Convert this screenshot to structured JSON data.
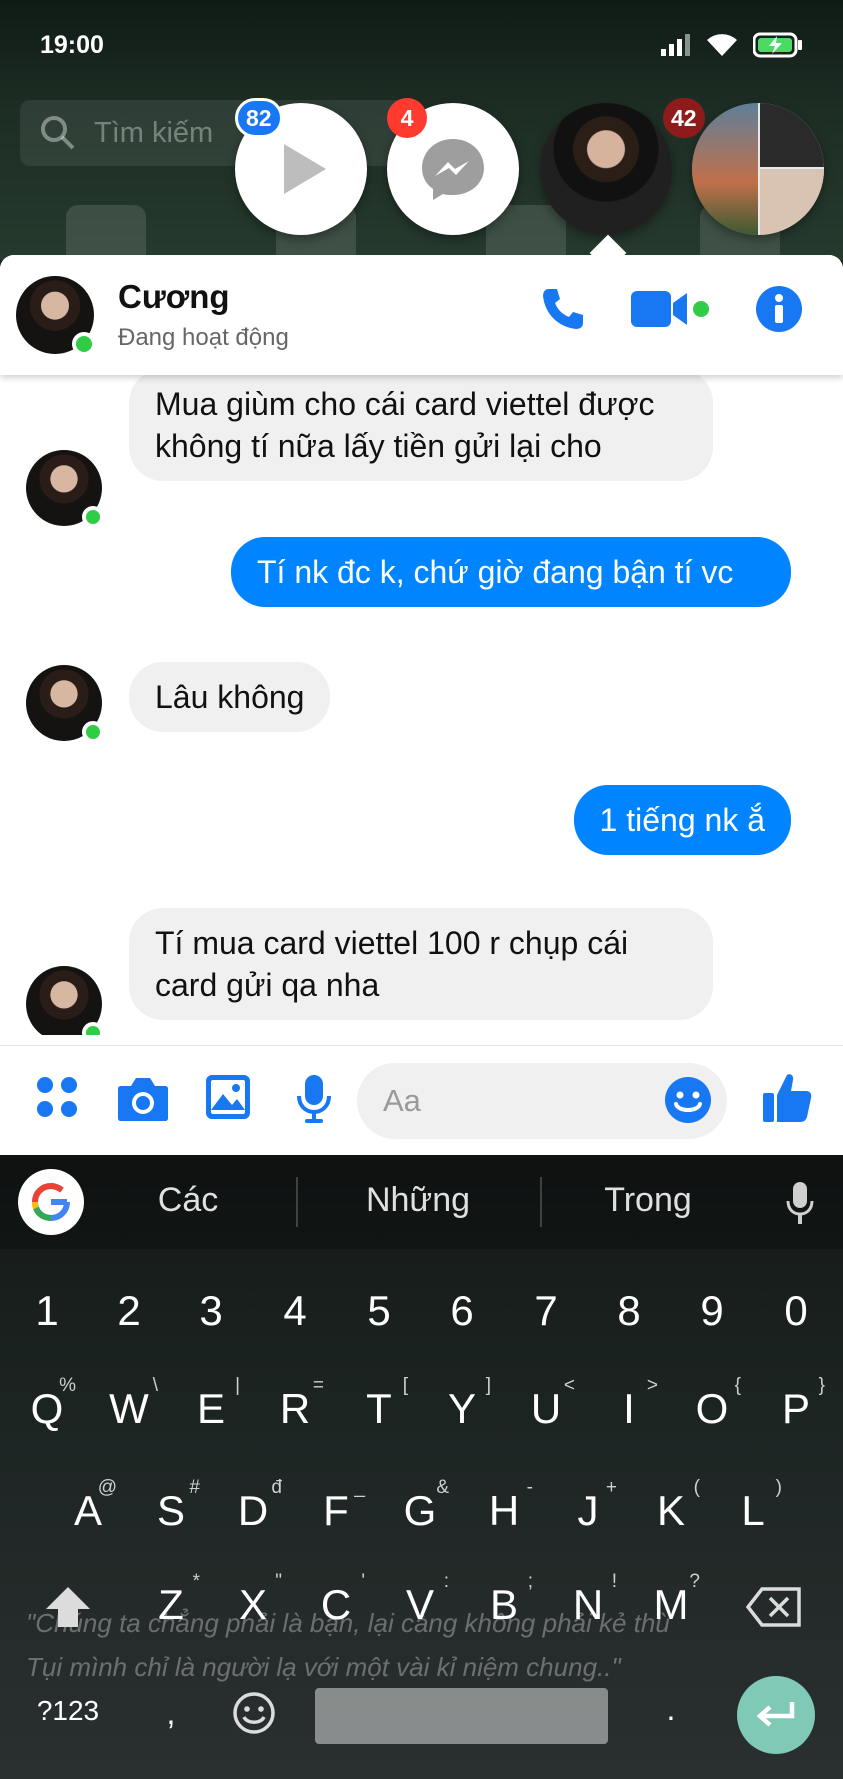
{
  "status_bar": {
    "time": "19:00"
  },
  "background": {
    "search_placeholder": "Tìm kiếm"
  },
  "chat_heads": [
    {
      "name": "video-app",
      "badge": "82"
    },
    {
      "name": "messenger",
      "badge": "4"
    },
    {
      "name": "cuong-avatar",
      "badge": "42"
    },
    {
      "name": "group-avatar",
      "badge": ""
    }
  ],
  "header": {
    "contact_name": "Cương",
    "contact_status": "Đang hoạt động"
  },
  "messages": [
    {
      "direction": "in",
      "text": "Mua giùm cho  cái card viettel được không tí nữa  lấy tiền gửi lại cho"
    },
    {
      "direction": "out",
      "text": "Tí nk đc k, chứ giờ đang bận tí vc"
    },
    {
      "direction": "in",
      "text": "Lâu không"
    },
    {
      "direction": "out",
      "text": "1 tiếng nk ắ"
    },
    {
      "direction": "in",
      "text": "Tí mua card viettel 100 r chụp cái card gửi qa nha"
    }
  ],
  "composer": {
    "placeholder": "Aa"
  },
  "keyboard": {
    "suggestions": [
      "Các",
      "Những",
      "Trong"
    ],
    "numbers": [
      "1",
      "2",
      "3",
      "4",
      "5",
      "6",
      "7",
      "8",
      "9",
      "0"
    ],
    "row1": [
      "Q",
      "W",
      "E",
      "R",
      "T",
      "Y",
      "U",
      "I",
      "O",
      "P"
    ],
    "row1_sub": [
      "%",
      "\\",
      "|",
      "=",
      "[",
      "]",
      "<",
      ">",
      "{",
      "}"
    ],
    "row2": [
      "A",
      "S",
      "D",
      "F",
      "G",
      "H",
      "J",
      "K",
      "L"
    ],
    "row2_sub": [
      "@",
      "#",
      "đ",
      "_",
      "&",
      "-",
      "+",
      "(",
      ")"
    ],
    "row3": [
      "Z",
      "X",
      "C",
      "V",
      "B",
      "N",
      "M"
    ],
    "row3_sub": [
      "*",
      "\"",
      "'",
      ":",
      ";",
      "!",
      "?"
    ],
    "symbols_label": "?123",
    "comma": ",",
    "period": ".",
    "wallpaper_quote_line1": "\"Chúng ta chẳng phải là bạn, lại càng không phải kẻ thù",
    "wallpaper_quote_line2": "Tụi mình chỉ là người lạ với một vài kỉ niệm chung..\""
  },
  "colors": {
    "messenger_blue": "#0084ff",
    "icon_blue": "#1877f2",
    "online_green": "#31cc46",
    "enter_key": "#7fc9b6"
  }
}
